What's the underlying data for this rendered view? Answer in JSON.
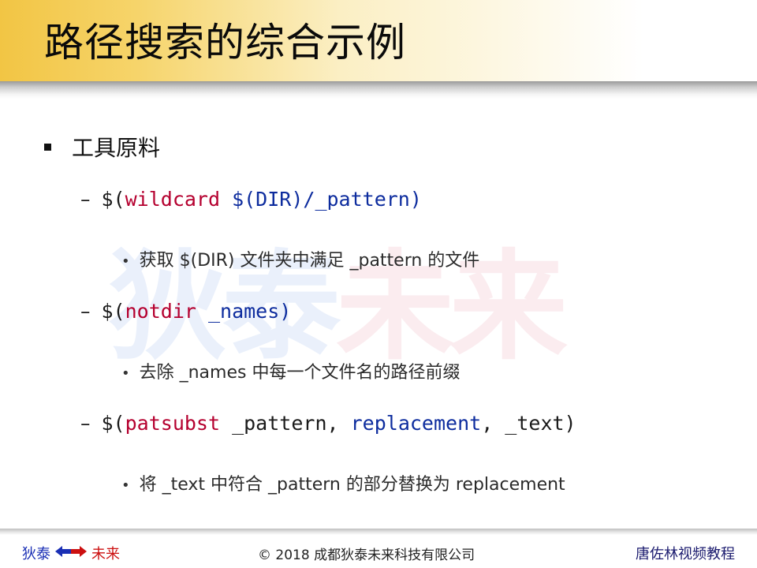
{
  "slide": {
    "title": "路径搜索的综合示例"
  },
  "watermark": {
    "part1": "狄泰",
    "part2": "未来"
  },
  "content": {
    "heading": "工具原料",
    "items": [
      {
        "prefix": "$(",
        "fn": "wildcard",
        "rest": " $(DIR)/_pattern)",
        "desc": "获取 $(DIR) 文件夹中满足 _pattern 的文件"
      },
      {
        "prefix": "$(",
        "fn": "notdir",
        "rest": " _names)",
        "desc": "去除 _names 中每一个文件名的路径前缀"
      },
      {
        "prefix": "$(",
        "fn": "patsubst",
        "mid": " _pattern, ",
        "arg": "replacement",
        "rest": ", _text)",
        "desc": "将 _text 中符合 _pattern 的部分替换为 replacement"
      }
    ]
  },
  "footer": {
    "brand_left": "狄泰",
    "brand_right": "未来",
    "copyright": "© 2018 成都狄泰未来科技有限公司",
    "course": "唐佐林视频教程"
  },
  "colors": {
    "function": "#b5002f",
    "argument": "#0d2c9e",
    "brand_blue": "#1a2fb5",
    "brand_red": "#cc1010"
  }
}
